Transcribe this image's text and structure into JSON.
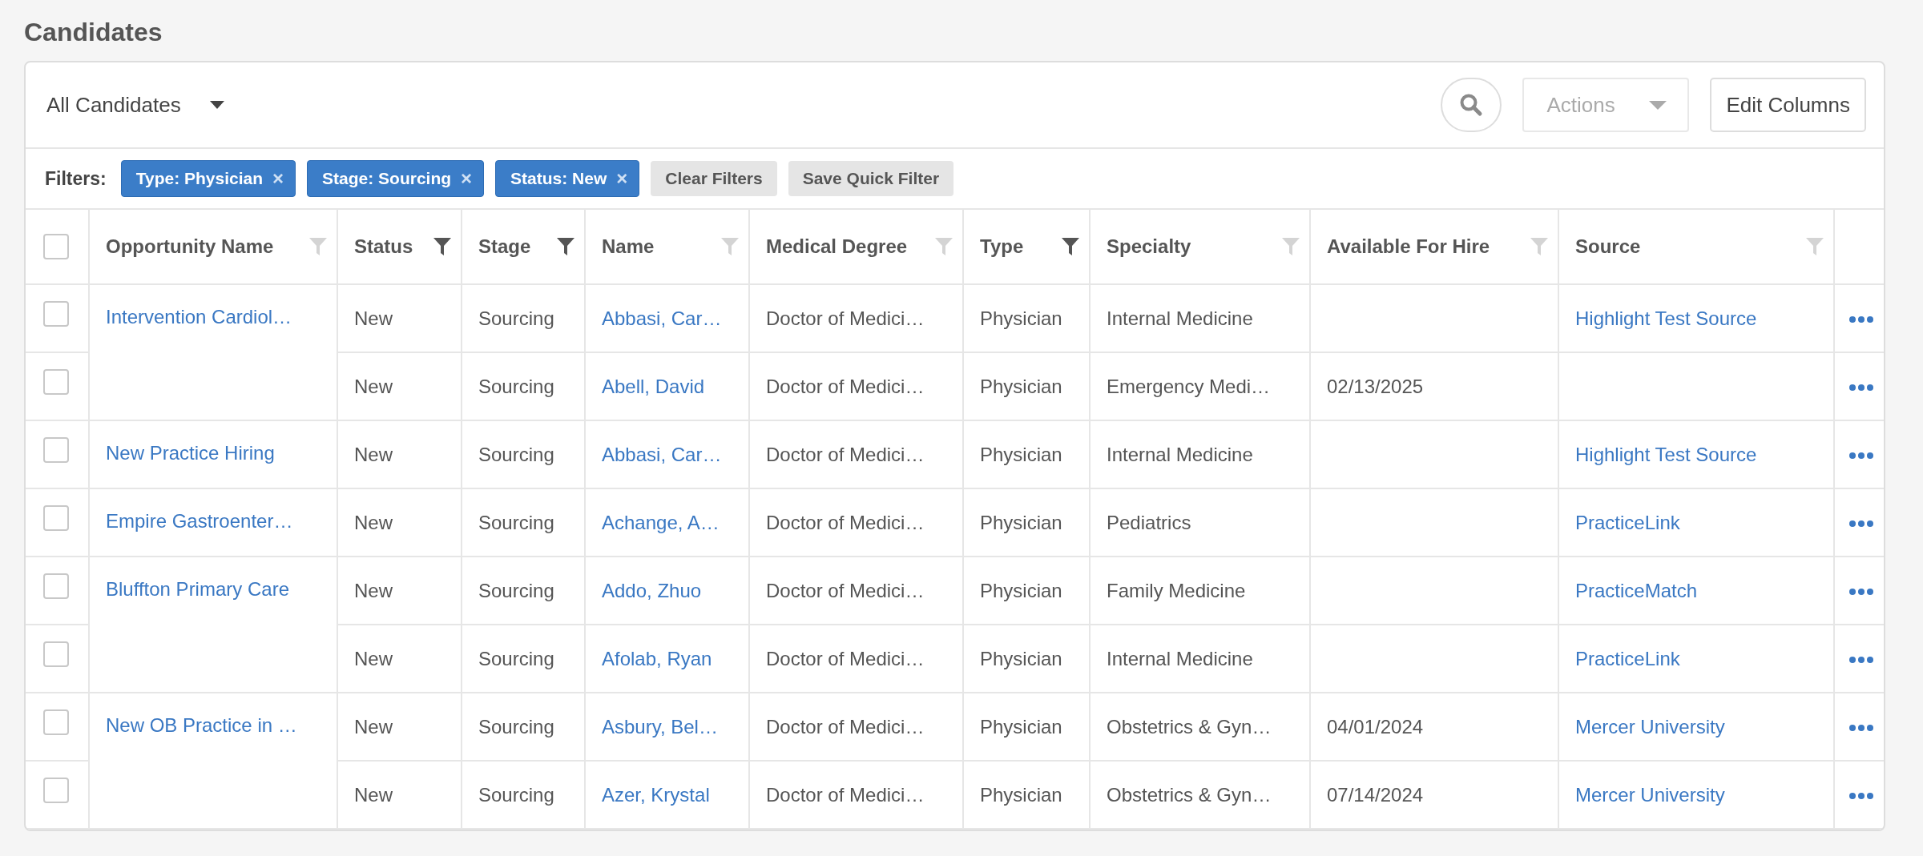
{
  "page_title": "Candidates",
  "view_select": {
    "label": "All Candidates"
  },
  "toolbar": {
    "actions": {
      "label": "Actions",
      "disabled": true
    },
    "edit_columns": "Edit Columns"
  },
  "filters": {
    "label": "Filters:",
    "chips": [
      {
        "label": "Type: Physician",
        "remove": "×"
      },
      {
        "label": "Stage: Sourcing",
        "remove": "×"
      },
      {
        "label": "Status: New",
        "remove": "×"
      }
    ],
    "buttons": [
      "Clear Filters",
      "Save Quick Filter"
    ]
  },
  "table": {
    "select_all": {
      "checked": false
    },
    "columns": [
      {
        "label": "Opportunity Name",
        "filter_active": false
      },
      {
        "label": "Status",
        "filter_active": true
      },
      {
        "label": "Stage",
        "filter_active": true
      },
      {
        "label": "Name",
        "filter_active": false
      },
      {
        "label": "Medical Degree",
        "filter_active": false
      },
      {
        "label": "Type",
        "filter_active": true
      },
      {
        "label": "Specialty",
        "filter_active": false
      },
      {
        "label": "Available For Hire",
        "filter_active": false
      },
      {
        "label": "Source",
        "filter_active": false
      }
    ],
    "groups": [
      {
        "opportunity": "Intervention Cardiol…",
        "candidates": [
          {
            "checked": false,
            "status": "New",
            "stage": "Sourcing",
            "name": "Abbasi, Car…",
            "degree": "Doctor of Medici…",
            "type": "Physician",
            "specialty": "Internal Medicine",
            "source": "Highlight Test Source"
          },
          {
            "checked": false,
            "status": "New",
            "stage": "Sourcing",
            "name": "Abell, David",
            "degree": "Doctor of Medici…",
            "type": "Physician",
            "specialty": "Emergency Medi…",
            "available": "02/13/2025"
          }
        ]
      },
      {
        "opportunity": "New Practice Hiring",
        "candidates": [
          {
            "checked": false,
            "status": "New",
            "stage": "Sourcing",
            "name": "Abbasi, Car…",
            "degree": "Doctor of Medici…",
            "type": "Physician",
            "specialty": "Internal Medicine",
            "source": "Highlight Test Source"
          }
        ]
      },
      {
        "opportunity": "Empire Gastroenter…",
        "candidates": [
          {
            "checked": false,
            "status": "New",
            "stage": "Sourcing",
            "name": "Achange, A…",
            "degree": "Doctor of Medici…",
            "type": "Physician",
            "specialty": "Pediatrics",
            "source": "PracticeLink"
          }
        ]
      },
      {
        "opportunity": "Bluffton Primary Care",
        "candidates": [
          {
            "checked": false,
            "status": "New",
            "stage": "Sourcing",
            "name": "Addo, Zhuo",
            "degree": "Doctor of Medici…",
            "type": "Physician",
            "specialty": "Family Medicine",
            "source": "PracticeMatch"
          },
          {
            "checked": false,
            "status": "New",
            "stage": "Sourcing",
            "name": "Afolab, Ryan",
            "degree": "Doctor of Medici…",
            "type": "Physician",
            "specialty": "Internal Medicine",
            "source": "PracticeLink"
          }
        ]
      },
      {
        "opportunity": "New OB Practice in …",
        "candidates": [
          {
            "checked": false,
            "status": "New",
            "stage": "Sourcing",
            "name": "Asbury, Bel…",
            "degree": "Doctor of Medici…",
            "type": "Physician",
            "specialty": "Obstetrics & Gyn…",
            "available": "04/01/2024",
            "source": "Mercer University"
          },
          {
            "checked": false,
            "status": "New",
            "stage": "Sourcing",
            "name": "Azer, Krystal",
            "degree": "Doctor of Medici…",
            "type": "Physician",
            "specialty": "Obstetrics & Gyn…",
            "available": "07/14/2024",
            "source": "Mercer University"
          }
        ]
      }
    ]
  }
}
